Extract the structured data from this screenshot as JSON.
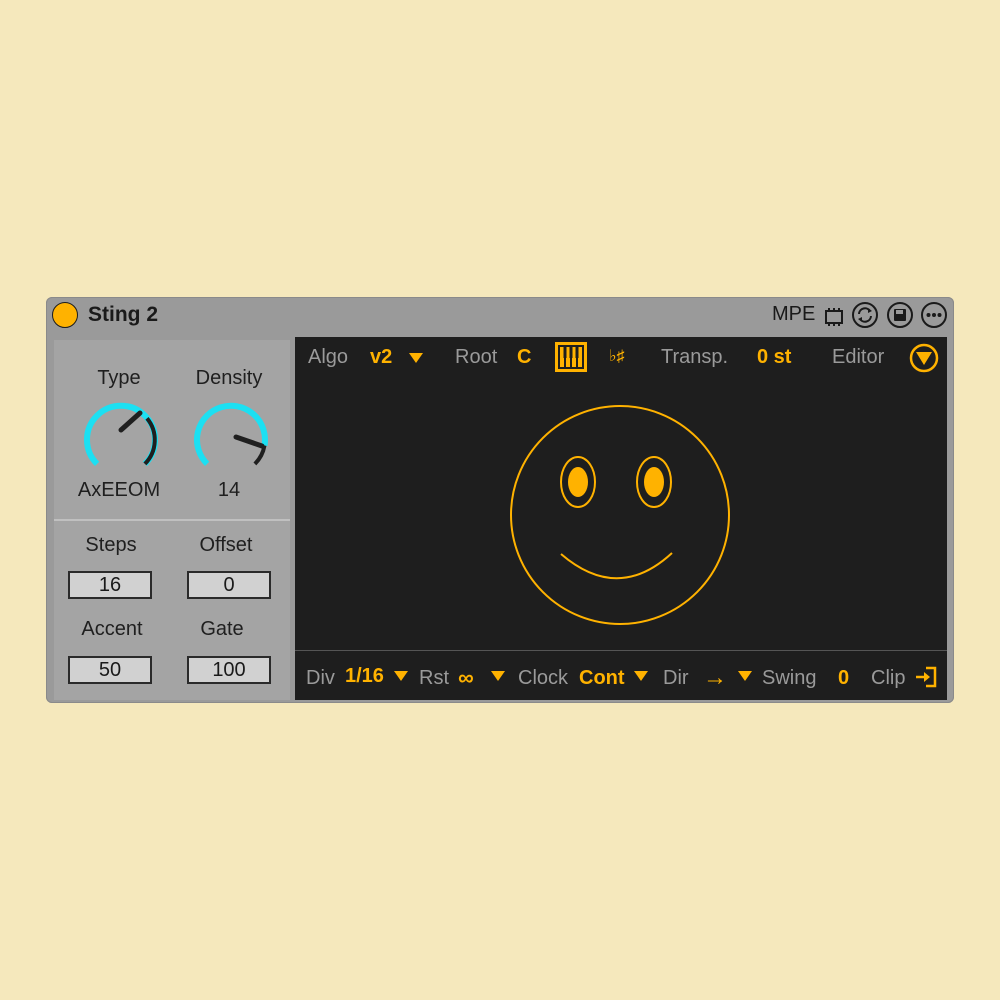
{
  "device": {
    "name": "Sting 2",
    "mpe_label": "MPE",
    "accent_color": "#ffb200",
    "knob_color": "#1ce0f2",
    "header_icons": [
      "mpe-chip-icon",
      "hot-swap-icon",
      "save-icon",
      "more-options-icon"
    ]
  },
  "left": {
    "type": {
      "label": "Type",
      "value": "AxEEOM"
    },
    "density": {
      "label": "Density",
      "value": "14"
    },
    "steps": {
      "label": "Steps",
      "value": "16"
    },
    "offset": {
      "label": "Offset",
      "value": "0"
    },
    "accent": {
      "label": "Accent",
      "value": "50"
    },
    "gate": {
      "label": "Gate",
      "value": "100"
    }
  },
  "top": {
    "algo_label": "Algo",
    "algo_value": "v2",
    "root_label": "Root",
    "root_value": "C",
    "flat_sharp": "♭♯",
    "transp_label": "Transp.",
    "transp_value": "0 st",
    "editor_label": "Editor"
  },
  "bottom": {
    "div_label": "Div",
    "div_value": "1/16",
    "rst_label": "Rst",
    "rst_value": "∞",
    "clock_label": "Clock",
    "clock_value": "Cont",
    "dir_label": "Dir",
    "dir_value": "→",
    "swing_label": "Swing",
    "swing_value": "0",
    "clip_label": "Clip"
  }
}
